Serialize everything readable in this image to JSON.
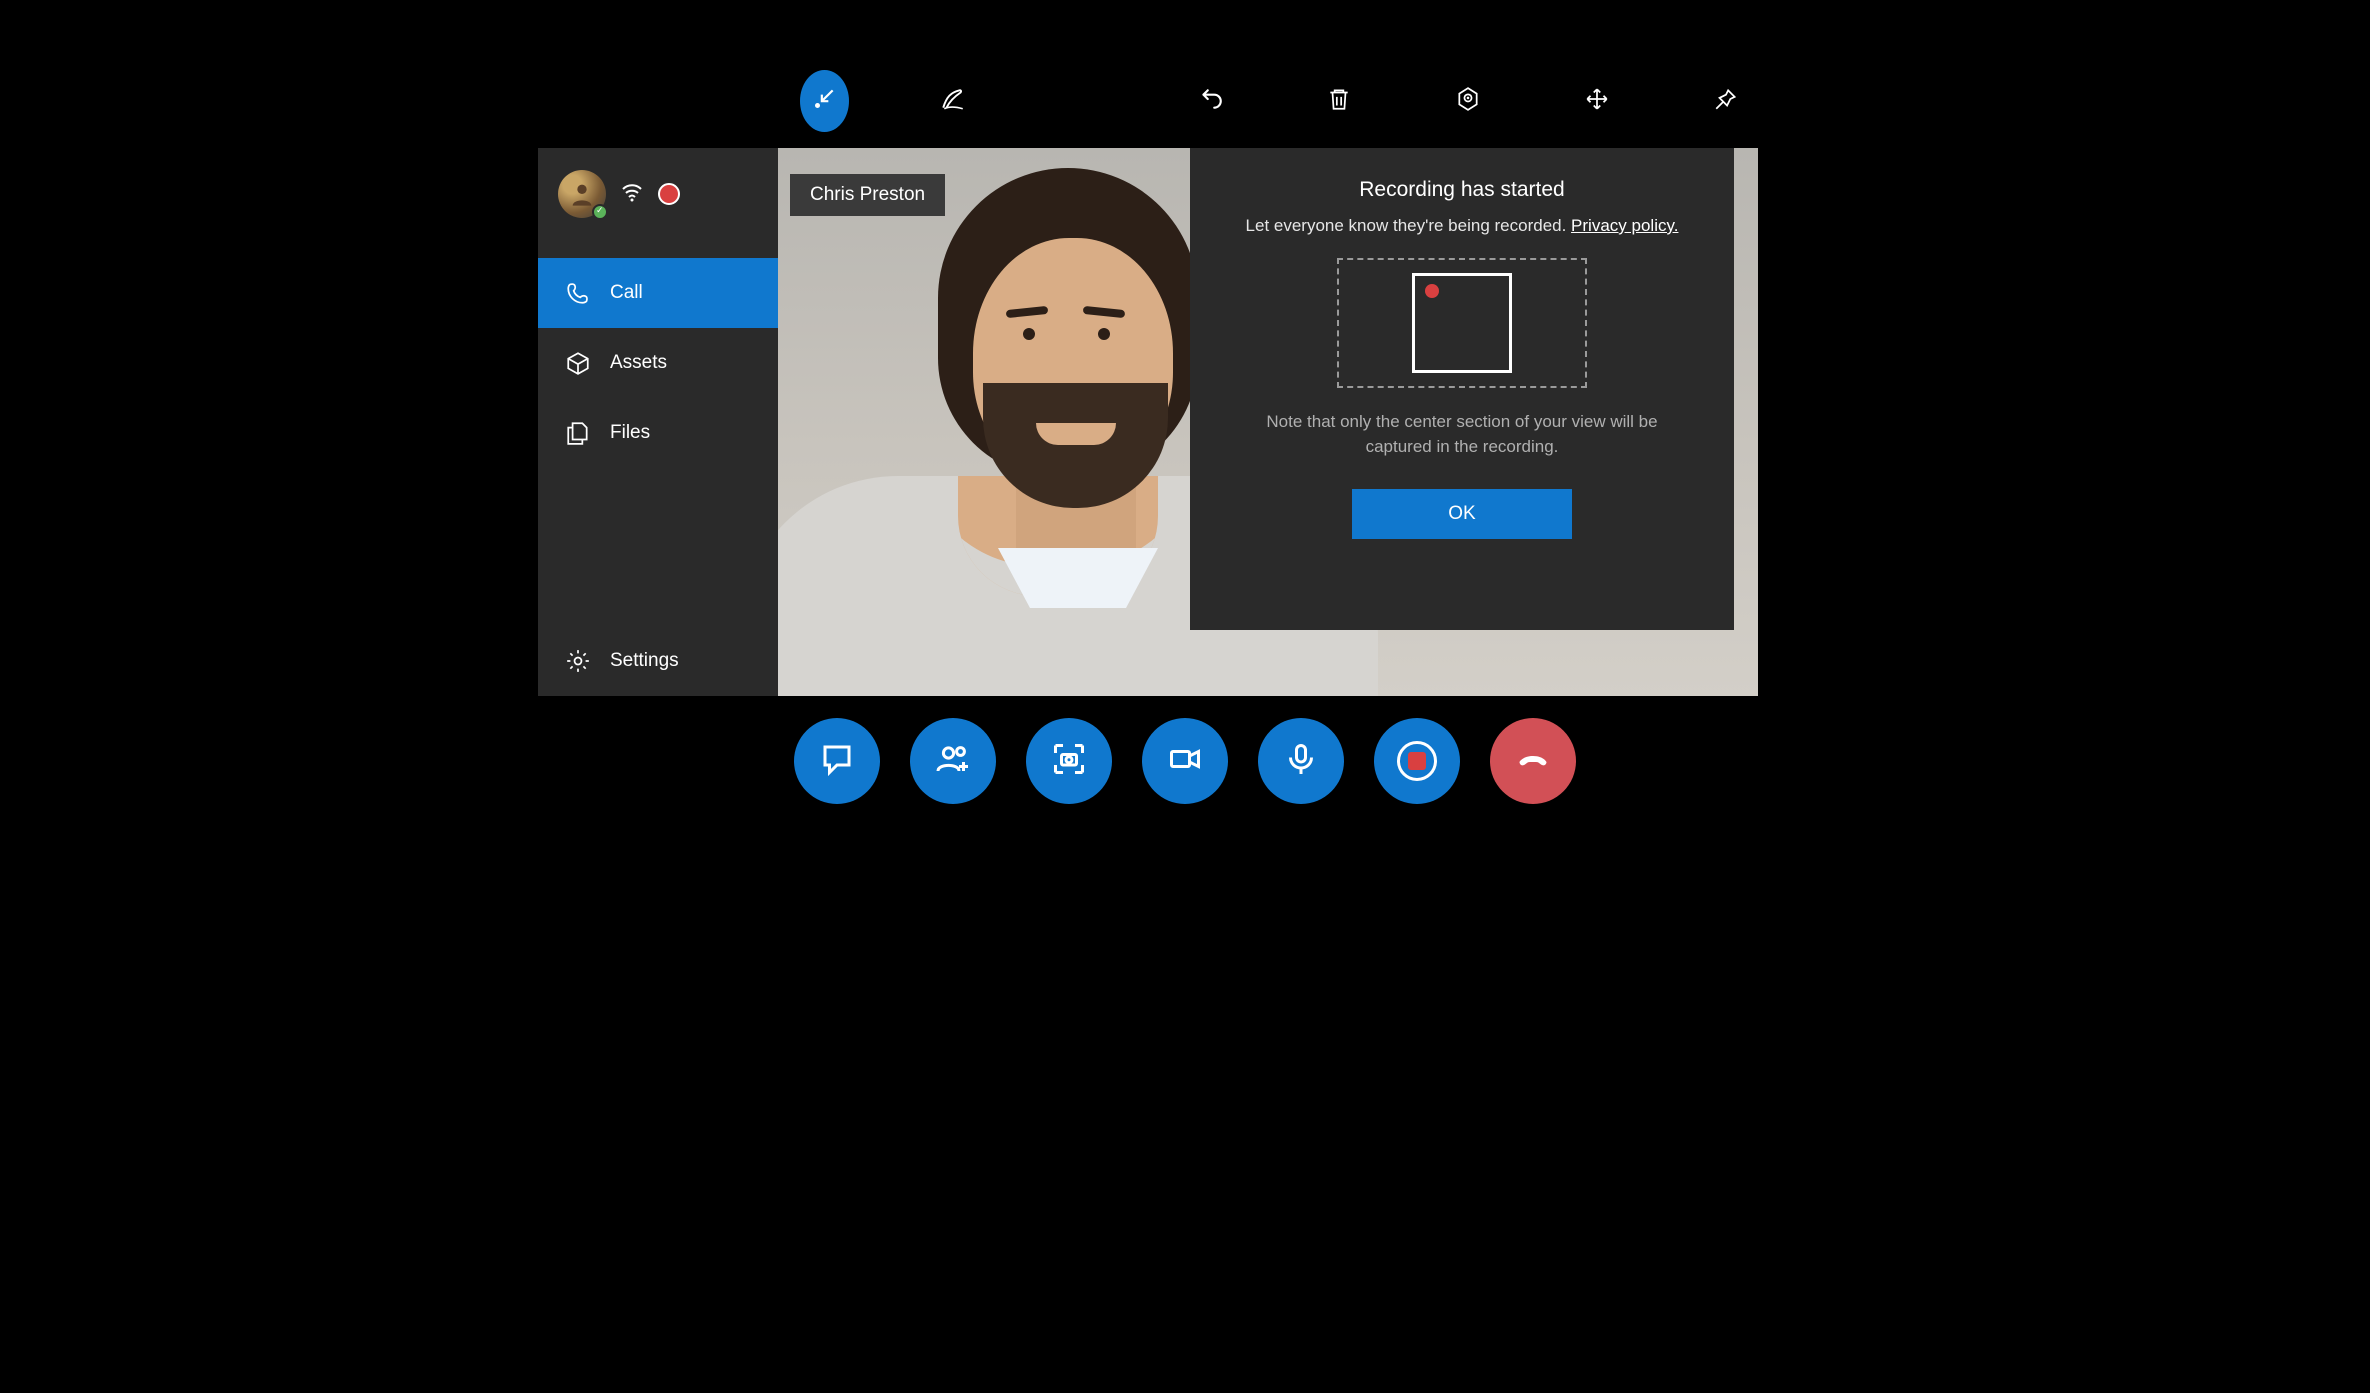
{
  "participant": {
    "name": "Chris Preston"
  },
  "sidebar": {
    "items": [
      {
        "label": "Call",
        "icon": "phone-icon",
        "active": true
      },
      {
        "label": "Assets",
        "icon": "box-icon",
        "active": false
      },
      {
        "label": "Files",
        "icon": "files-icon",
        "active": false
      }
    ],
    "settings_label": "Settings"
  },
  "toolbar": {
    "items": [
      {
        "name": "minimize-icon",
        "active": true
      },
      {
        "name": "ink-icon",
        "active": false
      },
      {
        "name": "stop-icon",
        "active": false
      },
      {
        "name": "undo-icon",
        "active": false
      },
      {
        "name": "delete-icon",
        "active": false
      },
      {
        "name": "location-icon",
        "active": false
      },
      {
        "name": "move-icon",
        "active": false
      },
      {
        "name": "pin-icon",
        "active": false
      }
    ]
  },
  "dialog": {
    "title": "Recording has started",
    "subtitle_prefix": "Let everyone know they're being recorded. ",
    "privacy_link": "Privacy policy.",
    "note": "Note that only the center section of your view will be captured in the recording.",
    "ok_label": "OK"
  },
  "callbar": {
    "buttons": [
      {
        "name": "chat-button",
        "icon": "chat-icon"
      },
      {
        "name": "add-people-button",
        "icon": "people-add-icon"
      },
      {
        "name": "capture-button",
        "icon": "camera-capture-icon"
      },
      {
        "name": "video-button",
        "icon": "video-icon"
      },
      {
        "name": "mic-button",
        "icon": "mic-icon"
      },
      {
        "name": "record-button",
        "icon": "record-icon"
      },
      {
        "name": "end-call-button",
        "icon": "hangup-icon",
        "end": true
      }
    ]
  },
  "colors": {
    "accent": "#1078ce",
    "danger": "#d25056",
    "record": "#d94040"
  }
}
